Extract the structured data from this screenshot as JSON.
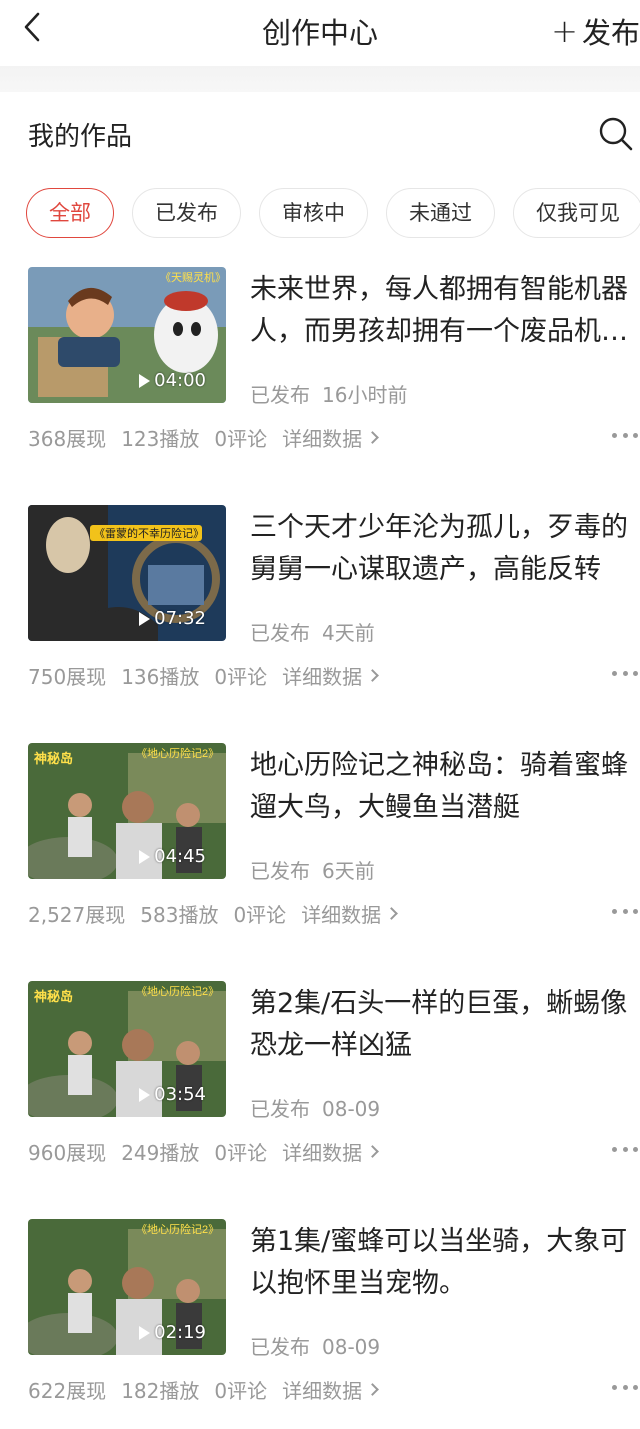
{
  "header": {
    "title": "创作中心",
    "publish_label": "发布"
  },
  "section": {
    "title": "我的作品"
  },
  "filters": [
    "全部",
    "已发布",
    "审核中",
    "未通过",
    "仅我可见"
  ],
  "items": [
    {
      "title": "未来世界，每人都拥有智能机器人，而男孩却拥有一个废品机器人",
      "duration": "04:00",
      "status": "已发布",
      "time": "16小时前",
      "impressions": "368展现",
      "plays": "123播放",
      "comments": "0评论",
      "detail": "详细数据",
      "thumb_caption": "《天赐灵机》"
    },
    {
      "title": "三个天才少年沦为孤儿，歹毒的舅舅一心谋取遗产，高能反转",
      "duration": "07:32",
      "status": "已发布",
      "time": "4天前",
      "impressions": "750展现",
      "plays": "136播放",
      "comments": "0评论",
      "detail": "详细数据",
      "thumb_caption": "《雷蒙的不幸历险记》"
    },
    {
      "title": "地心历险记之神秘岛：骑着蜜蜂遛大鸟，大鳗鱼当潜艇",
      "duration": "04:45",
      "status": "已发布",
      "time": "6天前",
      "impressions": "2,527展现",
      "plays": "583播放",
      "comments": "0评论",
      "detail": "详细数据",
      "thumb_caption": "《地心历险记2》"
    },
    {
      "title": "第2集/石头一样的巨蛋，蜥蜴像恐龙一样凶猛",
      "duration": "03:54",
      "status": "已发布",
      "time": "08-09",
      "impressions": "960展现",
      "plays": "249播放",
      "comments": "0评论",
      "detail": "详细数据",
      "thumb_caption": "《地心历险记2》"
    },
    {
      "title": "第1集/蜜蜂可以当坐骑，大象可以抱怀里当宠物。",
      "duration": "02:19",
      "status": "已发布",
      "time": "08-09",
      "impressions": "622展现",
      "plays": "182播放",
      "comments": "0评论",
      "detail": "详细数据",
      "thumb_caption": "《地心历险记2》"
    }
  ],
  "colors": {
    "accent": "#e0473e",
    "muted": "#999999"
  }
}
